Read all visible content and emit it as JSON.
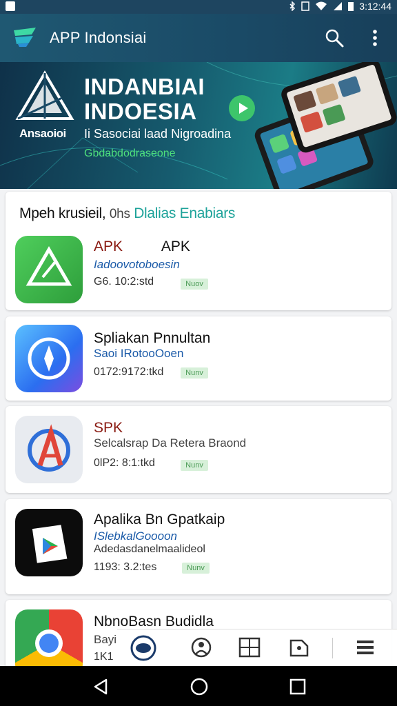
{
  "status": {
    "time": "3:12:44"
  },
  "appbar": {
    "title": "APP Indonsiai",
    "search_icon": "search-icon",
    "more_icon": "more-vert-icon"
  },
  "banner": {
    "title_line1": "INDANBIAI",
    "title_line2": "INDOESIA",
    "logo_text": "Ansaoioi",
    "tagline": "Ii Sasociai laad Nigroadina",
    "tagline2": "Gbdabdodraseone"
  },
  "section": {
    "title": "Mpeh krusieil,",
    "title_suffix": "0hs",
    "accent": "Dlalias Enabiars"
  },
  "apps": [
    {
      "name": "APK",
      "name2": "APK",
      "subtitle": "Iadoovotoboesin",
      "meta": "G6. 10:2:std",
      "badge": "Nuov",
      "icon": "apk-installer-icon",
      "name_color": "#8a1a12",
      "subtitle_color": "#1a5aa8"
    },
    {
      "name": "Spliakan Pnnultan",
      "name2": "",
      "subtitle": "Saoi IRotooOoen",
      "meta": "0172:9172:tkd",
      "badge": "Nunv",
      "icon": "compass-icon",
      "name_color": "#111111",
      "subtitle_color": "#1a5aa8"
    },
    {
      "name": "SPK",
      "name2": "",
      "subtitle": "Selcalsrap Da Retera Braond",
      "meta": "0lP2: 8:1:tkd",
      "badge": "Nunv",
      "icon": "app-store-icon",
      "name_color": "#8a1a12",
      "subtitle_color": "#444444"
    },
    {
      "name": "Apalika Bn Gpatkaip",
      "name2": "",
      "subtitle": "ISlebkalGoooon",
      "meta2": "Adedasdanelmaalideol",
      "meta": "1193: 3.2:tes",
      "badge": "Nunv",
      "icon": "play-store-icon",
      "name_color": "#111111",
      "subtitle_color": "#1a5aa8"
    },
    {
      "name": "NbnoBasn Budidla",
      "name2": "",
      "subtitle": "Bayi",
      "meta": "1K1",
      "badge": "",
      "icon": "chrome-icon",
      "name_color": "#111111",
      "subtitle_color": "#444444"
    }
  ],
  "tabs": [
    "home-tab-icon",
    "profile-tab-icon",
    "grid-tab-icon",
    "puzzle-tab-icon",
    "menu-tab-icon"
  ],
  "nav": [
    "back-icon",
    "home-icon",
    "recents-icon"
  ]
}
